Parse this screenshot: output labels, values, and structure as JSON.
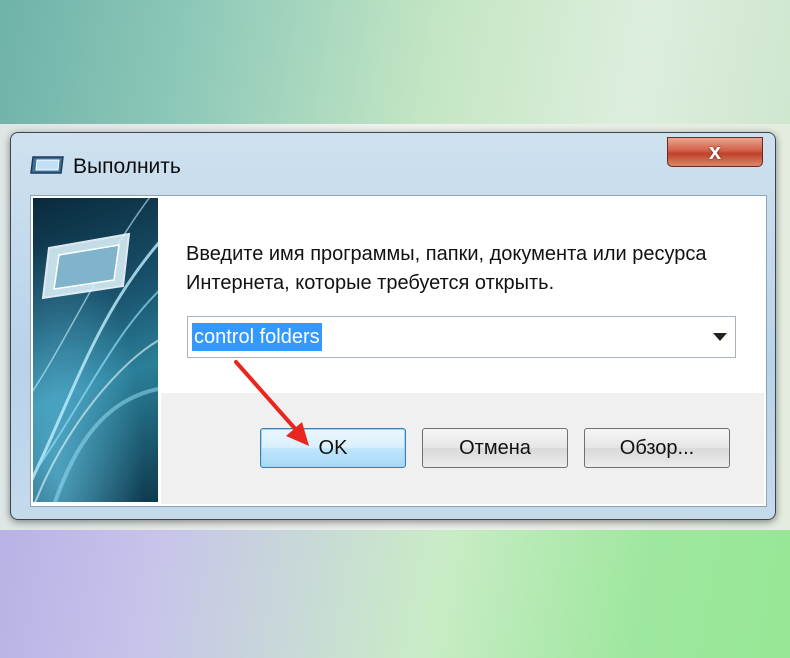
{
  "window": {
    "title": "Выполнить",
    "close_label": "x"
  },
  "dialog": {
    "prompt": "Введите имя программы, папки, документа или ресурса Интернета, которые требуется открыть.",
    "open_field": {
      "value": "control folders"
    },
    "buttons": {
      "ok": "OK",
      "cancel": "Отмена",
      "browse": "Обзор..."
    }
  },
  "colors": {
    "selection": "#3399ff",
    "annotation_arrow": "#e8261e",
    "close_button": "#c8452d"
  },
  "icons": [
    "run-icon",
    "close-icon",
    "dropdown-arrow-icon"
  ]
}
